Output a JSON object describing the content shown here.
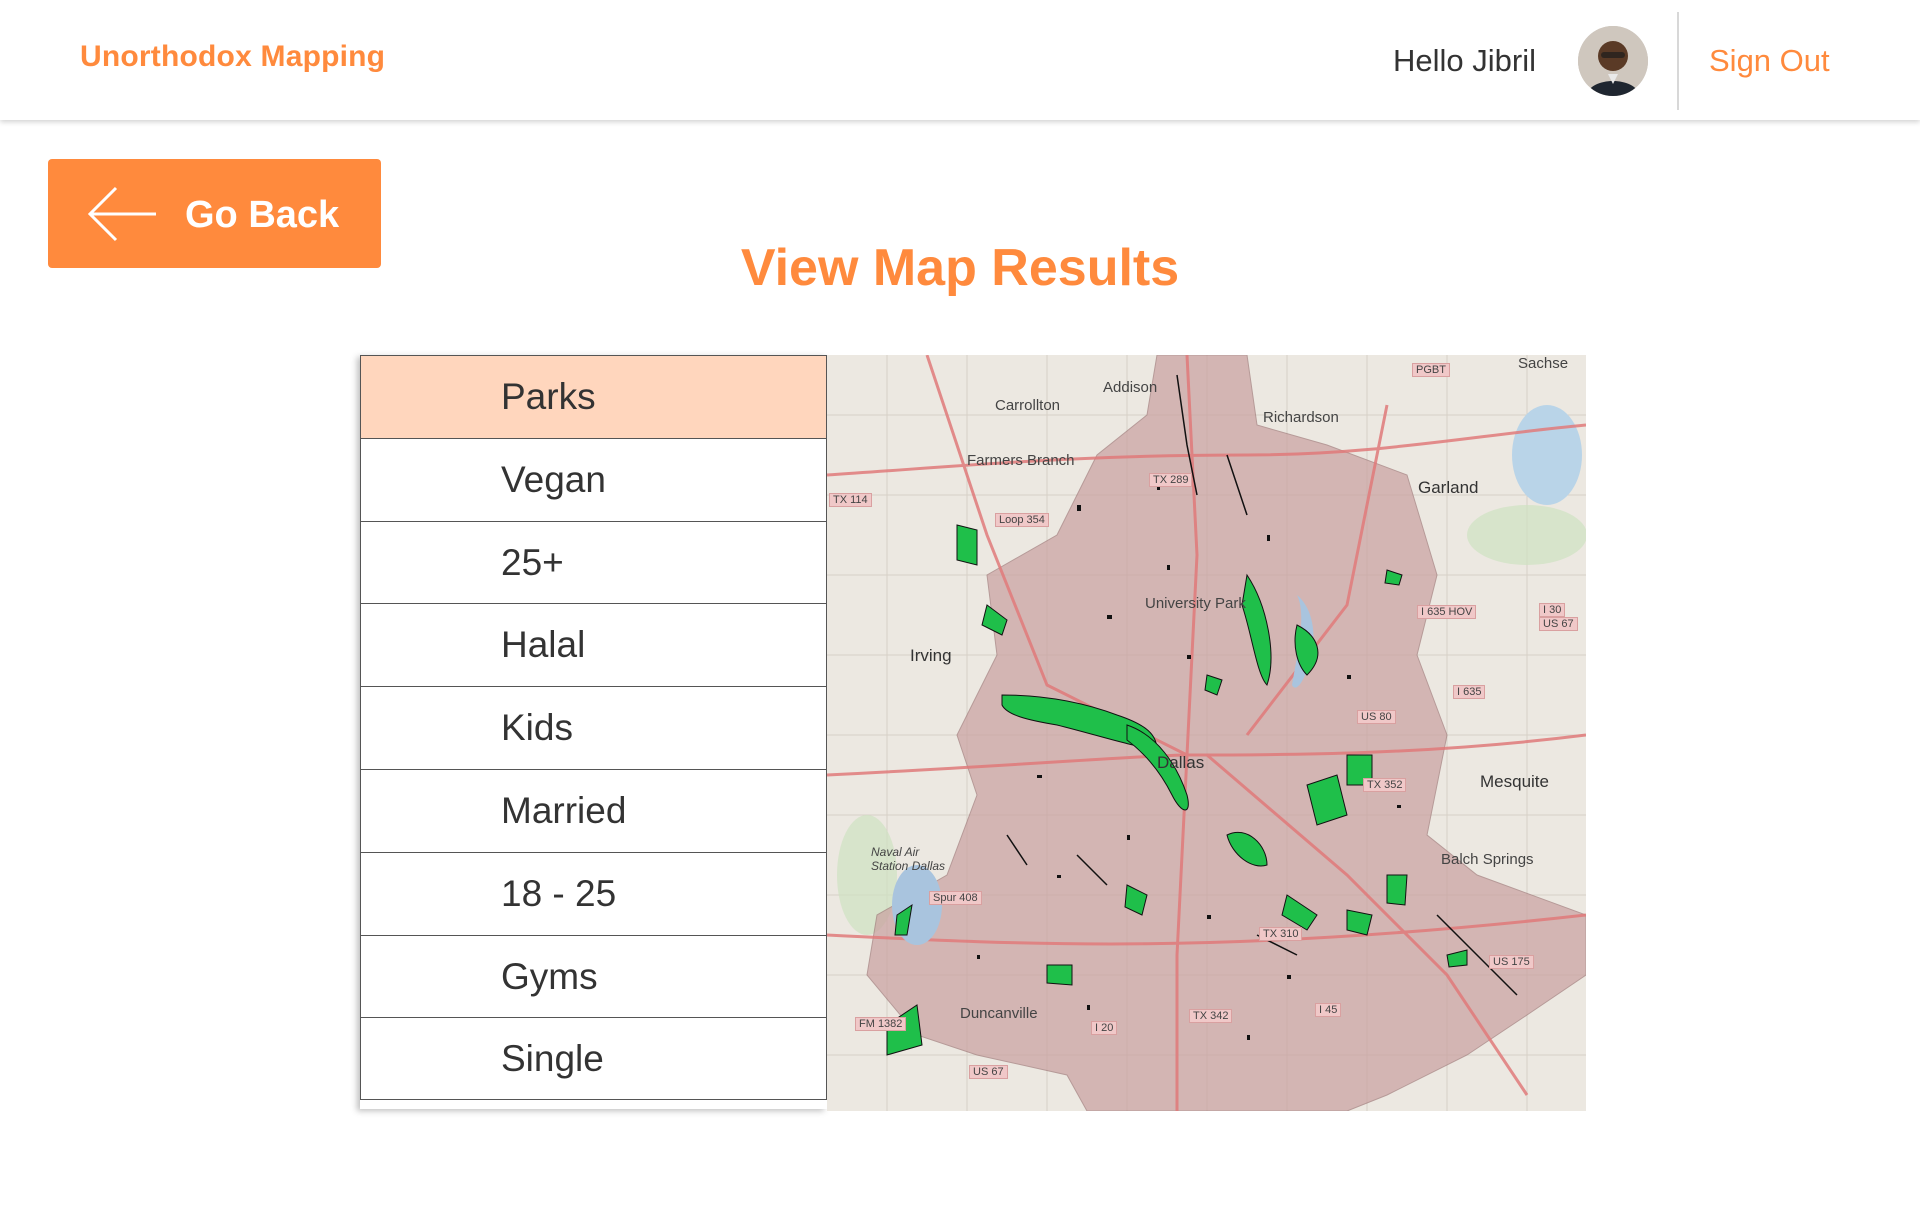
{
  "header": {
    "brand": "Unorthodox Mapping",
    "greeting": "Hello Jibril",
    "sign_out": "Sign Out"
  },
  "nav": {
    "go_back": "Go Back"
  },
  "page": {
    "title": "View Map Results"
  },
  "filters": [
    {
      "label": "Parks",
      "selected": true
    },
    {
      "label": "Vegan",
      "selected": false
    },
    {
      "label": "25+",
      "selected": false
    },
    {
      "label": "Halal",
      "selected": false
    },
    {
      "label": "Kids",
      "selected": false
    },
    {
      "label": "Married",
      "selected": false
    },
    {
      "label": "18 - 25",
      "selected": false
    },
    {
      "label": "Gyms",
      "selected": false
    },
    {
      "label": "Single",
      "selected": false
    }
  ],
  "map": {
    "places": [
      "Addison",
      "Carrollton",
      "Richardson",
      "Garland",
      "Sachse",
      "Farmers Branch",
      "University Park",
      "Irving",
      "Dallas",
      "Mesquite",
      "Balch Springs",
      "Duncanville",
      "Naval Air Station Dallas"
    ],
    "highways": [
      "PGBT",
      "TX 114",
      "Loop 354",
      "TX 289",
      "I 635 HOV",
      "I 30",
      "US 67",
      "I 635",
      "US 80",
      "TX 352",
      "Spur 408",
      "TX 310",
      "US 175",
      "TX 342",
      "I 20",
      "I 45",
      "FM 1382",
      "US 67"
    ],
    "colors": {
      "parks": "#1fbf4a",
      "city_area": "#c9a0a0"
    }
  },
  "colors": {
    "accent": "#ff8a3d",
    "selected_row": "#ffd6bd"
  }
}
